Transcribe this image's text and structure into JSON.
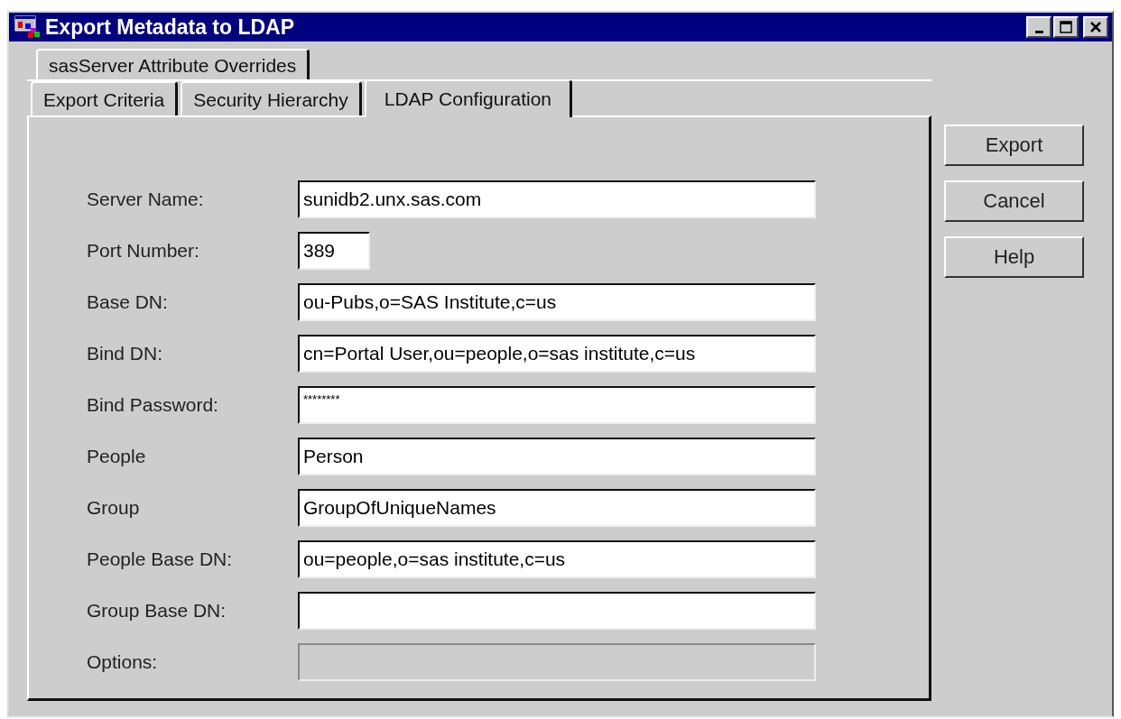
{
  "window": {
    "title": "Export Metadata to LDAP"
  },
  "tab_rows": [
    [
      {
        "label": "sasServer Attribute Overrides",
        "selected": false
      }
    ],
    [
      {
        "label": "Export Criteria",
        "selected": false
      },
      {
        "label": "Security Hierarchy",
        "selected": false
      },
      {
        "label": "LDAP Configuration",
        "selected": true
      }
    ]
  ],
  "fields": [
    {
      "label": "Server Name:",
      "value": "sunidb2.unx.sas.com",
      "kind": "text",
      "disabled": false
    },
    {
      "label": "Port Number:",
      "value": "389",
      "kind": "short",
      "disabled": false
    },
    {
      "label": "Base DN:",
      "value": "ou-Pubs,o=SAS Institute,c=us",
      "kind": "text",
      "disabled": false
    },
    {
      "label": "Bind DN:",
      "value": "cn=Portal User,ou=people,o=sas institute,c=us",
      "kind": "text",
      "disabled": false
    },
    {
      "label": "Bind Password:",
      "value": "********",
      "kind": "password",
      "disabled": false
    },
    {
      "label": "People",
      "value": "Person",
      "kind": "text",
      "disabled": false
    },
    {
      "label": "Group",
      "value": "GroupOfUniqueNames",
      "kind": "text",
      "disabled": false
    },
    {
      "label": "People Base DN:",
      "value": "ou=people,o=sas institute,c=us",
      "kind": "text",
      "disabled": false
    },
    {
      "label": "Group Base DN:",
      "kind": "text",
      "disabled": false
    },
    {
      "label": "Options:",
      "kind": "text",
      "disabled": true
    }
  ],
  "buttons": [
    "Export",
    "Cancel",
    "Help"
  ]
}
